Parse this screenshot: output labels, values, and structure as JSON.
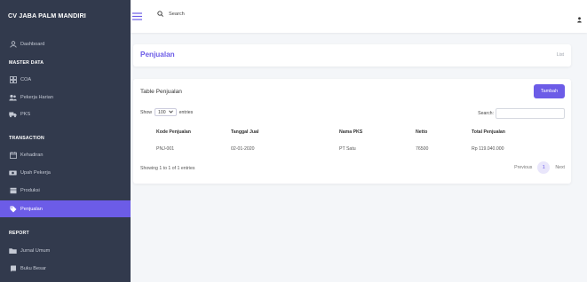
{
  "brand": "CV JABA PALM MANDIRI",
  "sidebar": {
    "dashboard": "Dashboard",
    "master_section": "MASTER DATA",
    "coa": "COA",
    "pekerja_harian": "Pekerja Harian",
    "pks": "PKS",
    "transaction_section": "TRANSACTION",
    "kehadiran": "Kehadiran",
    "upah_pekerja": "Upah Pekerja",
    "produksi": "Produksi",
    "penjualan": "Penjualan",
    "report_section": "REPORT",
    "jurnal_umum": "Jurnal Umum",
    "buku_besar": "Buku Besar"
  },
  "topbar": {
    "search_label": "Search"
  },
  "page": {
    "title": "Penjualan",
    "crumb": "List"
  },
  "table_card": {
    "title": "Table Penjualan",
    "add_button": "Tambah",
    "show_label": "Show",
    "show_value": "100",
    "entries_label": "entries",
    "search_label": "Search:",
    "columns": [
      "Kode Penjualan",
      "Tanggal Jual",
      "Nama PKS",
      "Netto",
      "Total Penjualan"
    ],
    "rows": [
      [
        "PNJ-001",
        "02-01-2020",
        "PT Satu",
        "76500",
        "Rp 119.040.000"
      ]
    ],
    "info": "Showing 1 to 1 of 1 entries",
    "previous": "Previous",
    "page": "1",
    "next": "Next"
  },
  "colors": {
    "accent": "#6c5ce7",
    "sidebar": "#323a4d"
  }
}
